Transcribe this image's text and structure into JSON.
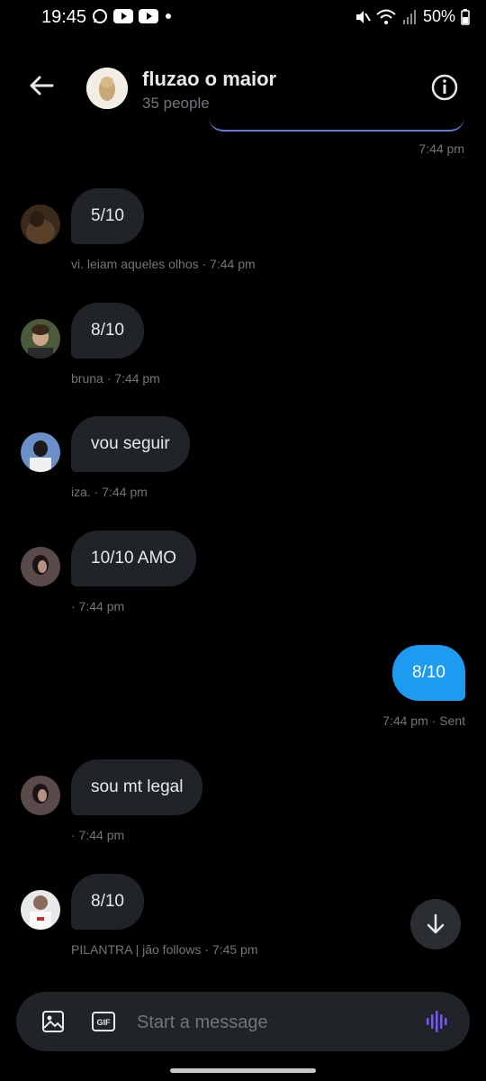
{
  "status_bar": {
    "time": "19:45",
    "battery": "50%"
  },
  "header": {
    "title": "fluzao o maior",
    "subtitle": "35 people"
  },
  "top_cutoff_time": "7:44 pm",
  "messages": [
    {
      "text": "5/10",
      "meta": "vi. leiam aqueles olhos · 7:44 pm"
    },
    {
      "text": "8/10",
      "meta": "bruna · 7:44 pm"
    },
    {
      "text": "vou seguir",
      "meta": "iza. · 7:44 pm"
    },
    {
      "text": "10/10 AMO",
      "meta": "· 7:44 pm"
    }
  ],
  "sent": {
    "text": "8/10",
    "meta": "7:44 pm · Sent"
  },
  "messages2": [
    {
      "text": "sou mt legal",
      "meta": "· 7:44 pm"
    },
    {
      "text": "8/10",
      "meta": "PILANTRA | jão follows · 7:45 pm"
    }
  ],
  "composer": {
    "placeholder": "Start a message"
  },
  "colors": {
    "accent": "#1d9bf0",
    "bubble": "#202327",
    "muted": "#71767b",
    "voice": "#7856ff"
  },
  "icons": [
    "back-arrow-icon",
    "info-icon",
    "image-icon",
    "gif-icon",
    "voice-icon",
    "arrow-down-icon"
  ]
}
